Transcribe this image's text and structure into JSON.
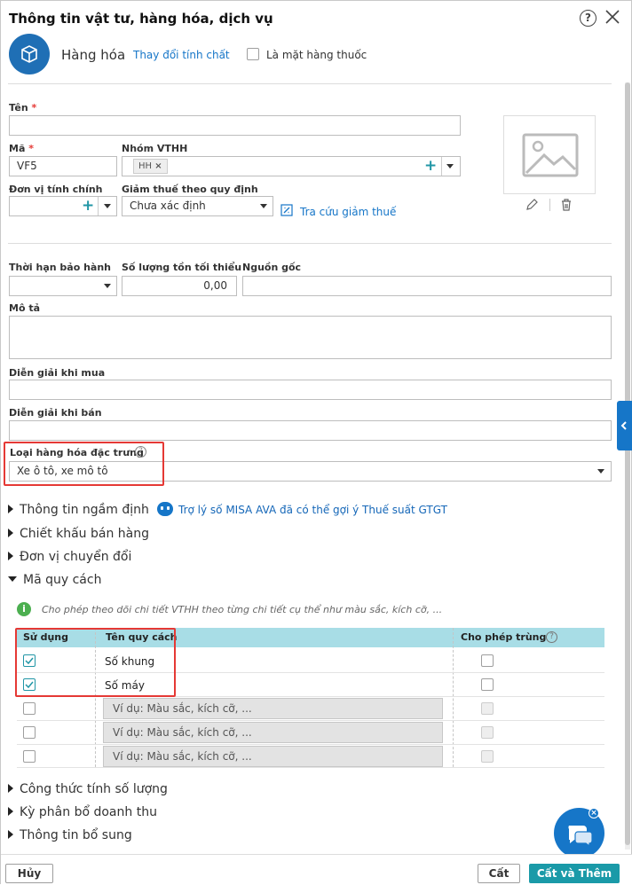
{
  "dialog": {
    "title": "Thông tin vật tư, hàng hóa, dịch vụ",
    "help": "?"
  },
  "header": {
    "type_label": "Hàng hóa",
    "change_link": "Thay đổi tính chất",
    "medicine_label": "Là mặt hàng thuốc"
  },
  "form": {
    "name_label": "Tên",
    "required_mark": "*",
    "name_value": "",
    "code_label": "Mã",
    "code_value": "VF5",
    "group_label": "Nhóm VTHH",
    "group_tag": "HH",
    "unit_label": "Đơn vị tính chính",
    "unit_value": "",
    "tax_label": "Giảm thuế theo quy định",
    "tax_value": "Chưa xác định",
    "tax_lookup_link": "Tra cứu giảm thuế",
    "warranty_label": "Thời hạn bảo hành",
    "min_stock_label": "Số lượng tồn tối thiểu",
    "min_stock_value": "0,00",
    "origin_label": "Nguồn gốc",
    "desc_label": "Mô tả",
    "purchase_desc_label": "Diễn giải khi mua",
    "sale_desc_label": "Diễn giải khi bán",
    "special_type_label": "Loại hàng hóa đặc trưng",
    "special_type_value": "Xe ô tô, xe mô tô"
  },
  "sections": {
    "implicit": "Thông tin ngầm định",
    "ava_link": "Trợ lý số MISA AVA đã có thể gợi ý Thuế suất GTGT",
    "discount": "Chiết khấu bán hàng",
    "conversion": "Đơn vị chuyển đổi",
    "spec": "Mã quy cách",
    "spec_info": "Cho phép theo dõi chi tiết VTHH theo từng chi tiết cụ thể như màu sắc, kích cỡ, ...",
    "formula": "Công thức tính số lượng",
    "revenue": "Kỳ phân bổ doanh thu",
    "extra": "Thông tin bổ sung"
  },
  "spec_table": {
    "col_use": "Sử dụng",
    "col_name": "Tên quy cách",
    "col_dup": "Cho phép trùng",
    "rows": [
      {
        "name": "Số khung"
      },
      {
        "name": "Số máy"
      }
    ],
    "placeholder": "Ví dụ: Màu sắc, kích cỡ, ..."
  },
  "footer": {
    "cancel": "Hủy",
    "save": "Cất",
    "save_add": "Cất và Thêm"
  },
  "colors": {
    "accent": "#1a9aa8",
    "highlight": "#e53935",
    "table_header": "#a8dde6"
  }
}
